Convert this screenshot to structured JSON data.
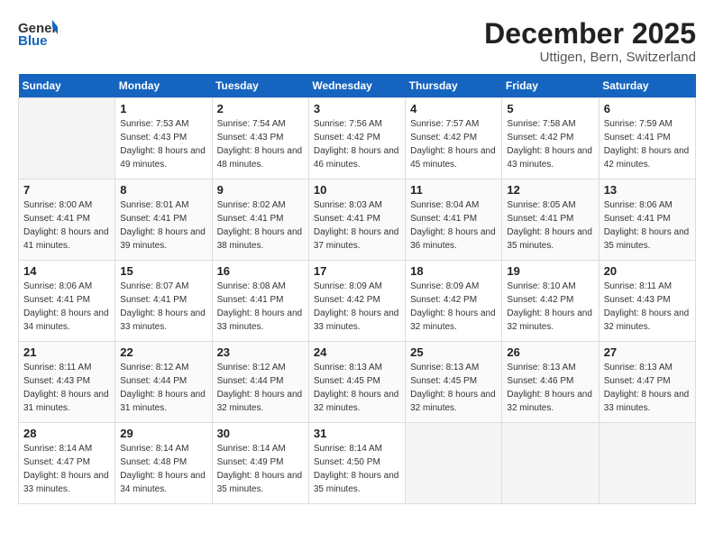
{
  "header": {
    "logo_general": "General",
    "logo_blue": "Blue",
    "month_title": "December 2025",
    "location": "Uttigen, Bern, Switzerland"
  },
  "days_of_week": [
    "Sunday",
    "Monday",
    "Tuesday",
    "Wednesday",
    "Thursday",
    "Friday",
    "Saturday"
  ],
  "weeks": [
    [
      {
        "day": "",
        "empty": true
      },
      {
        "day": "1",
        "sunrise": "Sunrise: 7:53 AM",
        "sunset": "Sunset: 4:43 PM",
        "daylight": "Daylight: 8 hours and 49 minutes."
      },
      {
        "day": "2",
        "sunrise": "Sunrise: 7:54 AM",
        "sunset": "Sunset: 4:43 PM",
        "daylight": "Daylight: 8 hours and 48 minutes."
      },
      {
        "day": "3",
        "sunrise": "Sunrise: 7:56 AM",
        "sunset": "Sunset: 4:42 PM",
        "daylight": "Daylight: 8 hours and 46 minutes."
      },
      {
        "day": "4",
        "sunrise": "Sunrise: 7:57 AM",
        "sunset": "Sunset: 4:42 PM",
        "daylight": "Daylight: 8 hours and 45 minutes."
      },
      {
        "day": "5",
        "sunrise": "Sunrise: 7:58 AM",
        "sunset": "Sunset: 4:42 PM",
        "daylight": "Daylight: 8 hours and 43 minutes."
      },
      {
        "day": "6",
        "sunrise": "Sunrise: 7:59 AM",
        "sunset": "Sunset: 4:41 PM",
        "daylight": "Daylight: 8 hours and 42 minutes."
      }
    ],
    [
      {
        "day": "7",
        "sunrise": "Sunrise: 8:00 AM",
        "sunset": "Sunset: 4:41 PM",
        "daylight": "Daylight: 8 hours and 41 minutes."
      },
      {
        "day": "8",
        "sunrise": "Sunrise: 8:01 AM",
        "sunset": "Sunset: 4:41 PM",
        "daylight": "Daylight: 8 hours and 39 minutes."
      },
      {
        "day": "9",
        "sunrise": "Sunrise: 8:02 AM",
        "sunset": "Sunset: 4:41 PM",
        "daylight": "Daylight: 8 hours and 38 minutes."
      },
      {
        "day": "10",
        "sunrise": "Sunrise: 8:03 AM",
        "sunset": "Sunset: 4:41 PM",
        "daylight": "Daylight: 8 hours and 37 minutes."
      },
      {
        "day": "11",
        "sunrise": "Sunrise: 8:04 AM",
        "sunset": "Sunset: 4:41 PM",
        "daylight": "Daylight: 8 hours and 36 minutes."
      },
      {
        "day": "12",
        "sunrise": "Sunrise: 8:05 AM",
        "sunset": "Sunset: 4:41 PM",
        "daylight": "Daylight: 8 hours and 35 minutes."
      },
      {
        "day": "13",
        "sunrise": "Sunrise: 8:06 AM",
        "sunset": "Sunset: 4:41 PM",
        "daylight": "Daylight: 8 hours and 35 minutes."
      }
    ],
    [
      {
        "day": "14",
        "sunrise": "Sunrise: 8:06 AM",
        "sunset": "Sunset: 4:41 PM",
        "daylight": "Daylight: 8 hours and 34 minutes."
      },
      {
        "day": "15",
        "sunrise": "Sunrise: 8:07 AM",
        "sunset": "Sunset: 4:41 PM",
        "daylight": "Daylight: 8 hours and 33 minutes."
      },
      {
        "day": "16",
        "sunrise": "Sunrise: 8:08 AM",
        "sunset": "Sunset: 4:41 PM",
        "daylight": "Daylight: 8 hours and 33 minutes."
      },
      {
        "day": "17",
        "sunrise": "Sunrise: 8:09 AM",
        "sunset": "Sunset: 4:42 PM",
        "daylight": "Daylight: 8 hours and 33 minutes."
      },
      {
        "day": "18",
        "sunrise": "Sunrise: 8:09 AM",
        "sunset": "Sunset: 4:42 PM",
        "daylight": "Daylight: 8 hours and 32 minutes."
      },
      {
        "day": "19",
        "sunrise": "Sunrise: 8:10 AM",
        "sunset": "Sunset: 4:42 PM",
        "daylight": "Daylight: 8 hours and 32 minutes."
      },
      {
        "day": "20",
        "sunrise": "Sunrise: 8:11 AM",
        "sunset": "Sunset: 4:43 PM",
        "daylight": "Daylight: 8 hours and 32 minutes."
      }
    ],
    [
      {
        "day": "21",
        "sunrise": "Sunrise: 8:11 AM",
        "sunset": "Sunset: 4:43 PM",
        "daylight": "Daylight: 8 hours and 31 minutes."
      },
      {
        "day": "22",
        "sunrise": "Sunrise: 8:12 AM",
        "sunset": "Sunset: 4:44 PM",
        "daylight": "Daylight: 8 hours and 31 minutes."
      },
      {
        "day": "23",
        "sunrise": "Sunrise: 8:12 AM",
        "sunset": "Sunset: 4:44 PM",
        "daylight": "Daylight: 8 hours and 32 minutes."
      },
      {
        "day": "24",
        "sunrise": "Sunrise: 8:13 AM",
        "sunset": "Sunset: 4:45 PM",
        "daylight": "Daylight: 8 hours and 32 minutes."
      },
      {
        "day": "25",
        "sunrise": "Sunrise: 8:13 AM",
        "sunset": "Sunset: 4:45 PM",
        "daylight": "Daylight: 8 hours and 32 minutes."
      },
      {
        "day": "26",
        "sunrise": "Sunrise: 8:13 AM",
        "sunset": "Sunset: 4:46 PM",
        "daylight": "Daylight: 8 hours and 32 minutes."
      },
      {
        "day": "27",
        "sunrise": "Sunrise: 8:13 AM",
        "sunset": "Sunset: 4:47 PM",
        "daylight": "Daylight: 8 hours and 33 minutes."
      }
    ],
    [
      {
        "day": "28",
        "sunrise": "Sunrise: 8:14 AM",
        "sunset": "Sunset: 4:47 PM",
        "daylight": "Daylight: 8 hours and 33 minutes."
      },
      {
        "day": "29",
        "sunrise": "Sunrise: 8:14 AM",
        "sunset": "Sunset: 4:48 PM",
        "daylight": "Daylight: 8 hours and 34 minutes."
      },
      {
        "day": "30",
        "sunrise": "Sunrise: 8:14 AM",
        "sunset": "Sunset: 4:49 PM",
        "daylight": "Daylight: 8 hours and 35 minutes."
      },
      {
        "day": "31",
        "sunrise": "Sunrise: 8:14 AM",
        "sunset": "Sunset: 4:50 PM",
        "daylight": "Daylight: 8 hours and 35 minutes."
      },
      {
        "day": "",
        "empty": true
      },
      {
        "day": "",
        "empty": true
      },
      {
        "day": "",
        "empty": true
      }
    ]
  ]
}
